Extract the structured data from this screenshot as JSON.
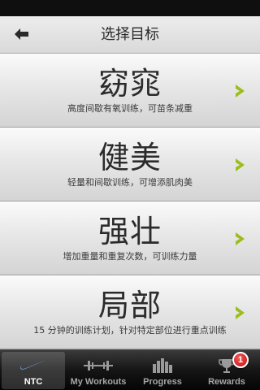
{
  "colors": {
    "accent_arrow": "#9bbe1e",
    "tabbar": "#101010",
    "badge": "#d61b1b"
  },
  "header": {
    "title": "选择目标",
    "back_icon": "arrow-left-icon"
  },
  "goals": [
    {
      "title": "窈窕",
      "subtitle": "高度间歇有氧训练，可苗条减重"
    },
    {
      "title": "健美",
      "subtitle": "轻量和间歇训练，可增添肌肉美"
    },
    {
      "title": "强壮",
      "subtitle": "增加重量和重复次数，可训练力量"
    },
    {
      "title": "局部",
      "subtitle": "15 分钟的训练计划，针对特定部位进行重点训练"
    }
  ],
  "tabbar": {
    "tabs": [
      {
        "label": "NTC",
        "icon": "swoosh-icon",
        "active": true
      },
      {
        "label": "My Workouts",
        "icon": "dumbbell-icon"
      },
      {
        "label": "Progress",
        "icon": "bar-chart-icon"
      },
      {
        "label": "Rewards",
        "icon": "trophy-icon",
        "badge": "1"
      }
    ]
  }
}
